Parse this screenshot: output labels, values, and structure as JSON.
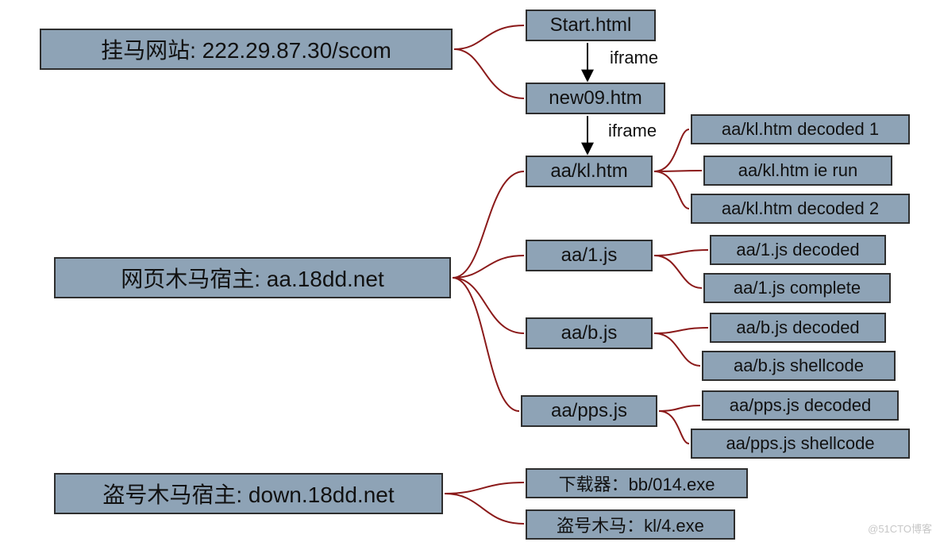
{
  "sections": {
    "hang_horse_site": "挂马网站: 222.29.87.30/scom",
    "trojan_host": "网页木马宿主: aa.18dd.net",
    "stealer_host": "盗号木马宿主: down.18dd.net"
  },
  "chain": {
    "start": "Start.html",
    "new09": "new09.htm",
    "kl": "aa/kl.htm",
    "one_js": "aa/1.js",
    "b_js": "aa/b.js",
    "pps_js": "aa/pps.js"
  },
  "kl_expand": {
    "d1": "aa/kl.htm decoded 1",
    "ie": "aa/kl.htm ie run",
    "d2": "aa/kl.htm decoded 2"
  },
  "one_expand": {
    "decoded": "aa/1.js decoded",
    "complete": "aa/1.js complete"
  },
  "b_expand": {
    "decoded": "aa/b.js decoded",
    "shellcode": "aa/b.js shellcode"
  },
  "pps_expand": {
    "decoded": "aa/pps.js decoded",
    "shellcode": "aa/pps.js shellcode"
  },
  "stealer_expand": {
    "downloader": "下载器：bb/014.exe",
    "trojan": "盗号木马：kl/4.exe"
  },
  "edge_labels": {
    "iframe1": "iframe",
    "iframe2": "iframe"
  },
  "watermark": "@51CTO博客"
}
